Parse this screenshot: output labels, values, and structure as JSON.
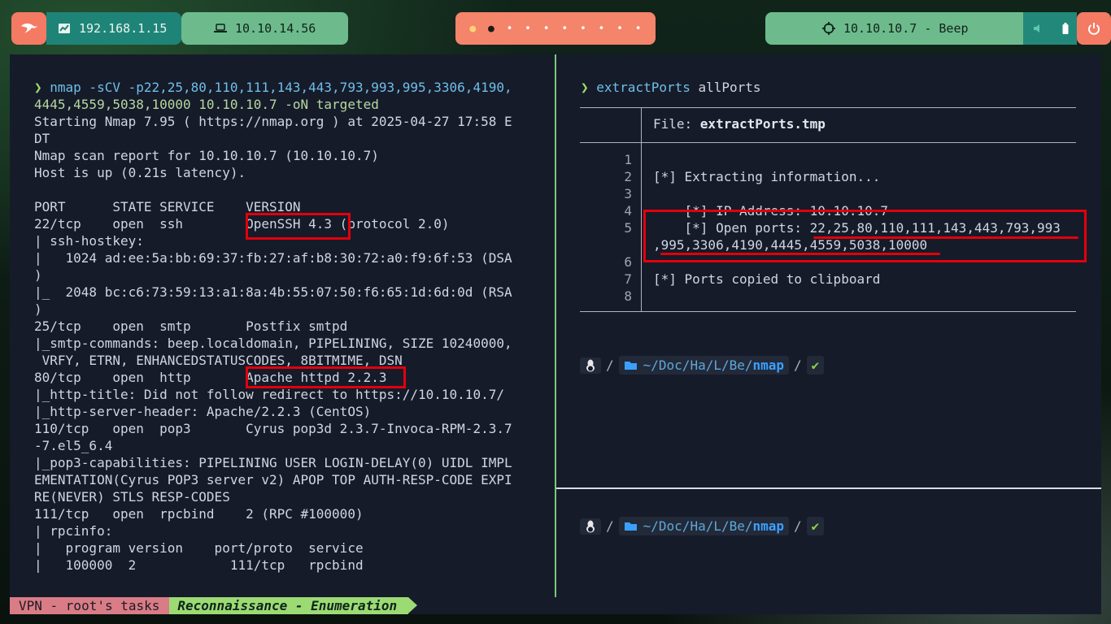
{
  "topbar": {
    "host_ip": "192.168.1.15",
    "vpn_ip": "10.10.14.56",
    "target": "10.10.10.7 - Beep",
    "workspaces": [
      "●",
      "●",
      "•",
      "•",
      "•",
      "•",
      "•",
      "•",
      "•",
      "•"
    ]
  },
  "left": {
    "lines": [
      "nmap -sCV -p22,25,80,110,111,143,443,793,993,995,3306,4190,",
      "4445,4559,5038,10000 10.10.10.7 -oN targeted",
      "Starting Nmap 7.95 ( https://nmap.org ) at 2025-04-27 17:58 E",
      "DT",
      "Nmap scan report for 10.10.10.7 (10.10.10.7)",
      "Host is up (0.21s latency).",
      "",
      "PORT      STATE SERVICE    VERSION",
      "22/tcp    open  ssh        OpenSSH 4.3 (protocol 2.0)",
      "| ssh-hostkey:",
      "|   1024 ad:ee:5a:bb:69:37:fb:27:af:b8:30:72:a0:f9:6f:53 (DSA",
      ")",
      "|_  2048 bc:c6:73:59:13:a1:8a:4b:55:07:50:f6:65:1d:6d:0d (RSA",
      ")",
      "25/tcp    open  smtp       Postfix smtpd",
      "|_smtp-commands: beep.localdomain, PIPELINING, SIZE 10240000,",
      " VRFY, ETRN, ENHANCEDSTATUSCODES, 8BITMIME, DSN",
      "80/tcp    open  http       Apache httpd 2.2.3",
      "|_http-title: Did not follow redirect to https://10.10.10.7/",
      "|_http-server-header: Apache/2.2.3 (CentOS)",
      "110/tcp   open  pop3       Cyrus pop3d 2.3.7-Invoca-RPM-2.3.7",
      "-7.el5_6.4",
      "|_pop3-capabilities: PIPELINING USER LOGIN-DELAY(0) UIDL IMPL",
      "EMENTATION(Cyrus POP3 server v2) APOP TOP AUTH-RESP-CODE EXPI",
      "RE(NEVER) STLS RESP-CODES",
      "111/tcp   open  rpcbind    2 (RPC #100000)",
      "| rpcinfo:",
      "|   program version    port/proto  service",
      "|   100000  2            111/tcp   rpcbind"
    ]
  },
  "right": {
    "command": "extractPorts",
    "argument": "allPorts",
    "file_label": "File: ",
    "file_name": "extractPorts.tmp",
    "line_numbers": [
      "1",
      "2",
      "3",
      "4",
      "5",
      "",
      "6",
      "7",
      "8"
    ],
    "body_lines": [
      "",
      "[*] Extracting information...",
      "",
      "    [*] IP Address: 10.10.10.7",
      "    [*] Open ports: 22,25,80,110,111,143,443,793,993",
      ",995,3306,4190,4445,4559,5038,10000",
      "",
      "[*] Ports copied to clipboard",
      ""
    ],
    "prompt": {
      "folder_icon": "folder-icon",
      "path_prefix": "~/Doc/Ha/L/Be/",
      "path_current": "nmap",
      "sep": "/",
      "check": "✔"
    }
  },
  "status": {
    "session": "VPN - root's tasks",
    "window": "Reconnaissance - Enumeration"
  },
  "colors": {
    "highlight": "#e3000b",
    "terminal_bg": "#161b2a",
    "pane_divider": "#7ac77a"
  }
}
